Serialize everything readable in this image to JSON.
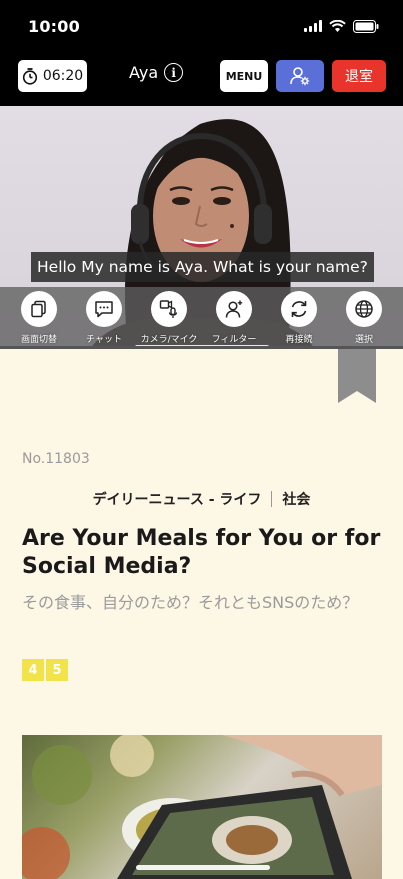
{
  "status_bar": {
    "time": "10:00"
  },
  "header": {
    "timer": "06:20",
    "host_name": "Aya",
    "info_glyph": "i",
    "menu_label": "MENU",
    "exit_label": "退室"
  },
  "video": {
    "caption": "Hello My name is Aya. What is your name?",
    "controls": [
      {
        "icon": "copy-icon",
        "label": "画面切替"
      },
      {
        "icon": "chat-icon",
        "label": "チャット"
      },
      {
        "icon": "camera-mic-icon",
        "label": "カメラ/マイク"
      },
      {
        "icon": "filter-user-icon",
        "label": "フィルター"
      },
      {
        "icon": "reconnect-icon",
        "label": "再接続"
      },
      {
        "icon": "globe-icon",
        "label": "選択"
      }
    ]
  },
  "article": {
    "number": "No.11803",
    "category": "デイリーニュース - ライフ",
    "subcategory": "社会",
    "title_en": "Are Your Meals for You or for Social Media?",
    "title_ja": "その食事、自分のため？それともSNSのため？",
    "levels": [
      "4",
      "5"
    ]
  },
  "colors": {
    "accent_blue": "#5a6fd8",
    "exit_red": "#e8342b",
    "level_yellow": "#f2e34a",
    "page_bg": "#fdf7e6"
  }
}
